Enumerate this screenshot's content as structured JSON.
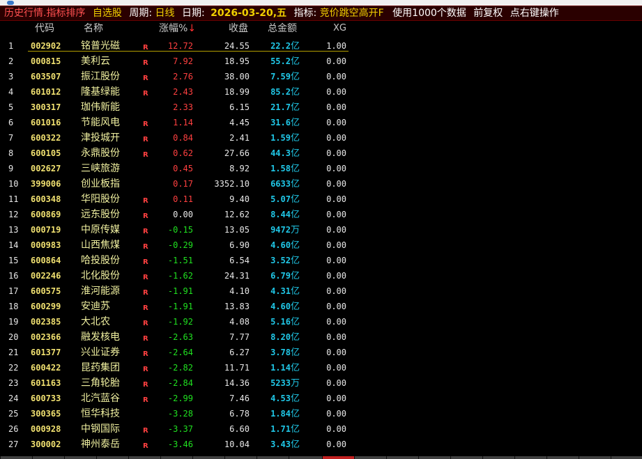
{
  "title_bar": {
    "mode": "历史行情.指标排序",
    "group": "自选股",
    "period_label": "周期:",
    "period_value": "日线",
    "date_label": "日期:",
    "date_value": "2026-03-20,五",
    "indicator_label": "指标:",
    "indicator_value": "竞价跳空高开F",
    "data_note": "使用1000个数据",
    "adjust": "前复权",
    "hint": "点右键操作"
  },
  "columns": {
    "code": "代码",
    "name": "名称",
    "change": "涨幅%",
    "sort_arrow": "↓",
    "close": "收盘",
    "amount": "总金额",
    "xg": "XG"
  },
  "rows": [
    {
      "idx": "1",
      "code": "002902",
      "name": "铭普光磁",
      "flag": "R",
      "change": "12.72",
      "dir": "up",
      "close": "24.55",
      "amount_num": "22.2",
      "amount_unit": "亿",
      "xg": "1.00"
    },
    {
      "idx": "2",
      "code": "000815",
      "name": "美利云",
      "flag": "R",
      "change": "7.92",
      "dir": "up",
      "close": "18.95",
      "amount_num": "55.2",
      "amount_unit": "亿",
      "xg": "0.00"
    },
    {
      "idx": "3",
      "code": "603507",
      "name": "振江股份",
      "flag": "R",
      "change": "2.76",
      "dir": "up",
      "close": "38.00",
      "amount_num": "7.59",
      "amount_unit": "亿",
      "xg": "0.00"
    },
    {
      "idx": "4",
      "code": "601012",
      "name": "隆基绿能",
      "flag": "R",
      "change": "2.43",
      "dir": "up",
      "close": "18.99",
      "amount_num": "85.2",
      "amount_unit": "亿",
      "xg": "0.00"
    },
    {
      "idx": "5",
      "code": "300317",
      "name": "珈伟新能",
      "flag": "",
      "change": "2.33",
      "dir": "up",
      "close": "6.15",
      "amount_num": "21.7",
      "amount_unit": "亿",
      "xg": "0.00"
    },
    {
      "idx": "6",
      "code": "601016",
      "name": "节能风电",
      "flag": "R",
      "change": "1.14",
      "dir": "up",
      "close": "4.45",
      "amount_num": "31.6",
      "amount_unit": "亿",
      "xg": "0.00"
    },
    {
      "idx": "7",
      "code": "600322",
      "name": "津投城开",
      "flag": "R",
      "change": "0.84",
      "dir": "up",
      "close": "2.41",
      "amount_num": "1.59",
      "amount_unit": "亿",
      "xg": "0.00"
    },
    {
      "idx": "8",
      "code": "600105",
      "name": "永鼎股份",
      "flag": "R",
      "change": "0.62",
      "dir": "up",
      "close": "27.66",
      "amount_num": "44.3",
      "amount_unit": "亿",
      "xg": "0.00"
    },
    {
      "idx": "9",
      "code": "002627",
      "name": "三峡旅游",
      "flag": "",
      "change": "0.45",
      "dir": "up",
      "close": "8.92",
      "amount_num": "1.58",
      "amount_unit": "亿",
      "xg": "0.00"
    },
    {
      "idx": "10",
      "code": "399006",
      "name": "创业板指",
      "flag": "",
      "change": "0.17",
      "dir": "up",
      "close": "3352.10",
      "amount_num": "6633",
      "amount_unit": "亿",
      "xg": "0.00"
    },
    {
      "idx": "11",
      "code": "600348",
      "name": "华阳股份",
      "flag": "R",
      "change": "0.11",
      "dir": "up",
      "close": "9.40",
      "amount_num": "5.07",
      "amount_unit": "亿",
      "xg": "0.00"
    },
    {
      "idx": "12",
      "code": "600869",
      "name": "远东股份",
      "flag": "R",
      "change": "0.00",
      "dir": "flat",
      "close": "12.62",
      "amount_num": "8.44",
      "amount_unit": "亿",
      "xg": "0.00"
    },
    {
      "idx": "13",
      "code": "000719",
      "name": "中原传媒",
      "flag": "R",
      "change": "-0.15",
      "dir": "down",
      "close": "13.05",
      "amount_num": "9472",
      "amount_unit": "万",
      "xg": "0.00"
    },
    {
      "idx": "14",
      "code": "000983",
      "name": "山西焦煤",
      "flag": "R",
      "change": "-0.29",
      "dir": "down",
      "close": "6.90",
      "amount_num": "4.60",
      "amount_unit": "亿",
      "xg": "0.00"
    },
    {
      "idx": "15",
      "code": "600864",
      "name": "哈投股份",
      "flag": "R",
      "change": "-1.51",
      "dir": "down",
      "close": "6.54",
      "amount_num": "3.52",
      "amount_unit": "亿",
      "xg": "0.00"
    },
    {
      "idx": "16",
      "code": "002246",
      "name": "北化股份",
      "flag": "R",
      "change": "-1.62",
      "dir": "down",
      "close": "24.31",
      "amount_num": "6.79",
      "amount_unit": "亿",
      "xg": "0.00"
    },
    {
      "idx": "17",
      "code": "600575",
      "name": "淮河能源",
      "flag": "R",
      "change": "-1.91",
      "dir": "down",
      "close": "4.10",
      "amount_num": "4.31",
      "amount_unit": "亿",
      "xg": "0.00"
    },
    {
      "idx": "18",
      "code": "600299",
      "name": "安迪苏",
      "flag": "R",
      "change": "-1.91",
      "dir": "down",
      "close": "13.83",
      "amount_num": "4.60",
      "amount_unit": "亿",
      "xg": "0.00"
    },
    {
      "idx": "19",
      "code": "002385",
      "name": "大北农",
      "flag": "R",
      "change": "-1.92",
      "dir": "down",
      "close": "4.08",
      "amount_num": "5.16",
      "amount_unit": "亿",
      "xg": "0.00"
    },
    {
      "idx": "20",
      "code": "002366",
      "name": "融发核电",
      "flag": "R",
      "change": "-2.63",
      "dir": "down",
      "close": "7.77",
      "amount_num": "8.20",
      "amount_unit": "亿",
      "xg": "0.00"
    },
    {
      "idx": "21",
      "code": "601377",
      "name": "兴业证券",
      "flag": "R",
      "change": "-2.64",
      "dir": "down",
      "close": "6.27",
      "amount_num": "3.78",
      "amount_unit": "亿",
      "xg": "0.00"
    },
    {
      "idx": "22",
      "code": "600422",
      "name": "昆药集团",
      "flag": "R",
      "change": "-2.82",
      "dir": "down",
      "close": "11.71",
      "amount_num": "1.14",
      "amount_unit": "亿",
      "xg": "0.00"
    },
    {
      "idx": "23",
      "code": "601163",
      "name": "三角轮胎",
      "flag": "R",
      "change": "-2.84",
      "dir": "down",
      "close": "14.36",
      "amount_num": "5233",
      "amount_unit": "万",
      "xg": "0.00"
    },
    {
      "idx": "24",
      "code": "600733",
      "name": "北汽蓝谷",
      "flag": "R",
      "change": "-2.99",
      "dir": "down",
      "close": "7.46",
      "amount_num": "4.53",
      "amount_unit": "亿",
      "xg": "0.00"
    },
    {
      "idx": "25",
      "code": "300365",
      "name": "恒华科技",
      "flag": "",
      "change": "-3.28",
      "dir": "down",
      "close": "6.78",
      "amount_num": "1.84",
      "amount_unit": "亿",
      "xg": "0.00"
    },
    {
      "idx": "26",
      "code": "000928",
      "name": "中钢国际",
      "flag": "R",
      "change": "-3.37",
      "dir": "down",
      "close": "6.60",
      "amount_num": "1.71",
      "amount_unit": "亿",
      "xg": "0.00"
    },
    {
      "idx": "27",
      "code": "300002",
      "name": "神州泰岳",
      "flag": "R",
      "change": "-3.46",
      "dir": "down",
      "close": "10.04",
      "amount_num": "3.43",
      "amount_unit": "亿",
      "xg": "0.00"
    }
  ]
}
